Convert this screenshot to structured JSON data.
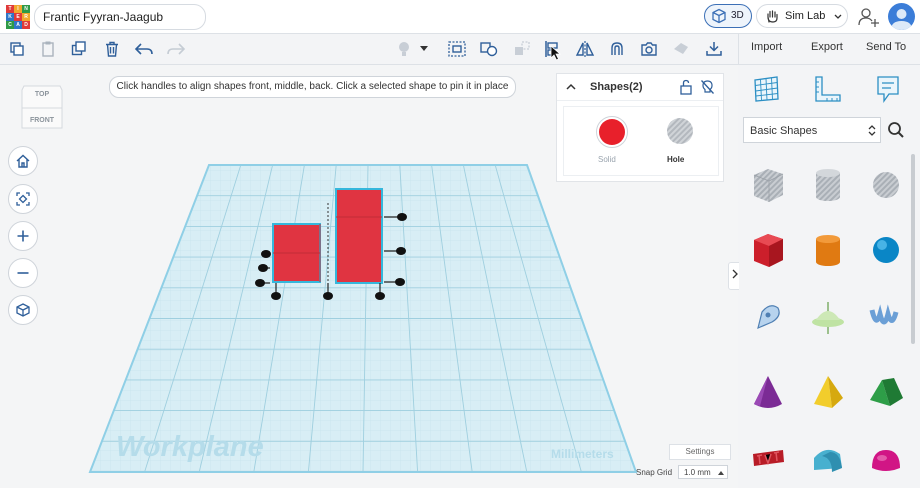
{
  "header": {
    "logo_letters": [
      "TIN",
      "KER",
      "CAD"
    ],
    "project_title": "Frantic Fyyran-Jaagub",
    "view_3d_label": "3D",
    "simlab_label": "Sim Lab"
  },
  "toolbar": {
    "import_label": "Import",
    "export_label": "Export",
    "send_to_label": "Send To"
  },
  "canvas": {
    "hint": "Click handles to align shapes front, middle, back. Click a selected shape to pin it in place",
    "viewcube_top": "TOP",
    "viewcube_front": "FRONT",
    "workplane_label": "Workplane",
    "units_label": "Millimeters",
    "settings_label": "Settings",
    "snap_grid_label": "Snap Grid",
    "snap_grid_value": "1.0 mm"
  },
  "shapes_panel": {
    "title": "Shapes(2)",
    "solid_label": "Solid",
    "hole_label": "Hole",
    "solid_color": "#e8202b"
  },
  "library": {
    "category": "Basic Shapes"
  },
  "colors": {
    "accent": "#3b6fb6",
    "shape_red": "#e03441",
    "workplane": "#d8eef5"
  }
}
